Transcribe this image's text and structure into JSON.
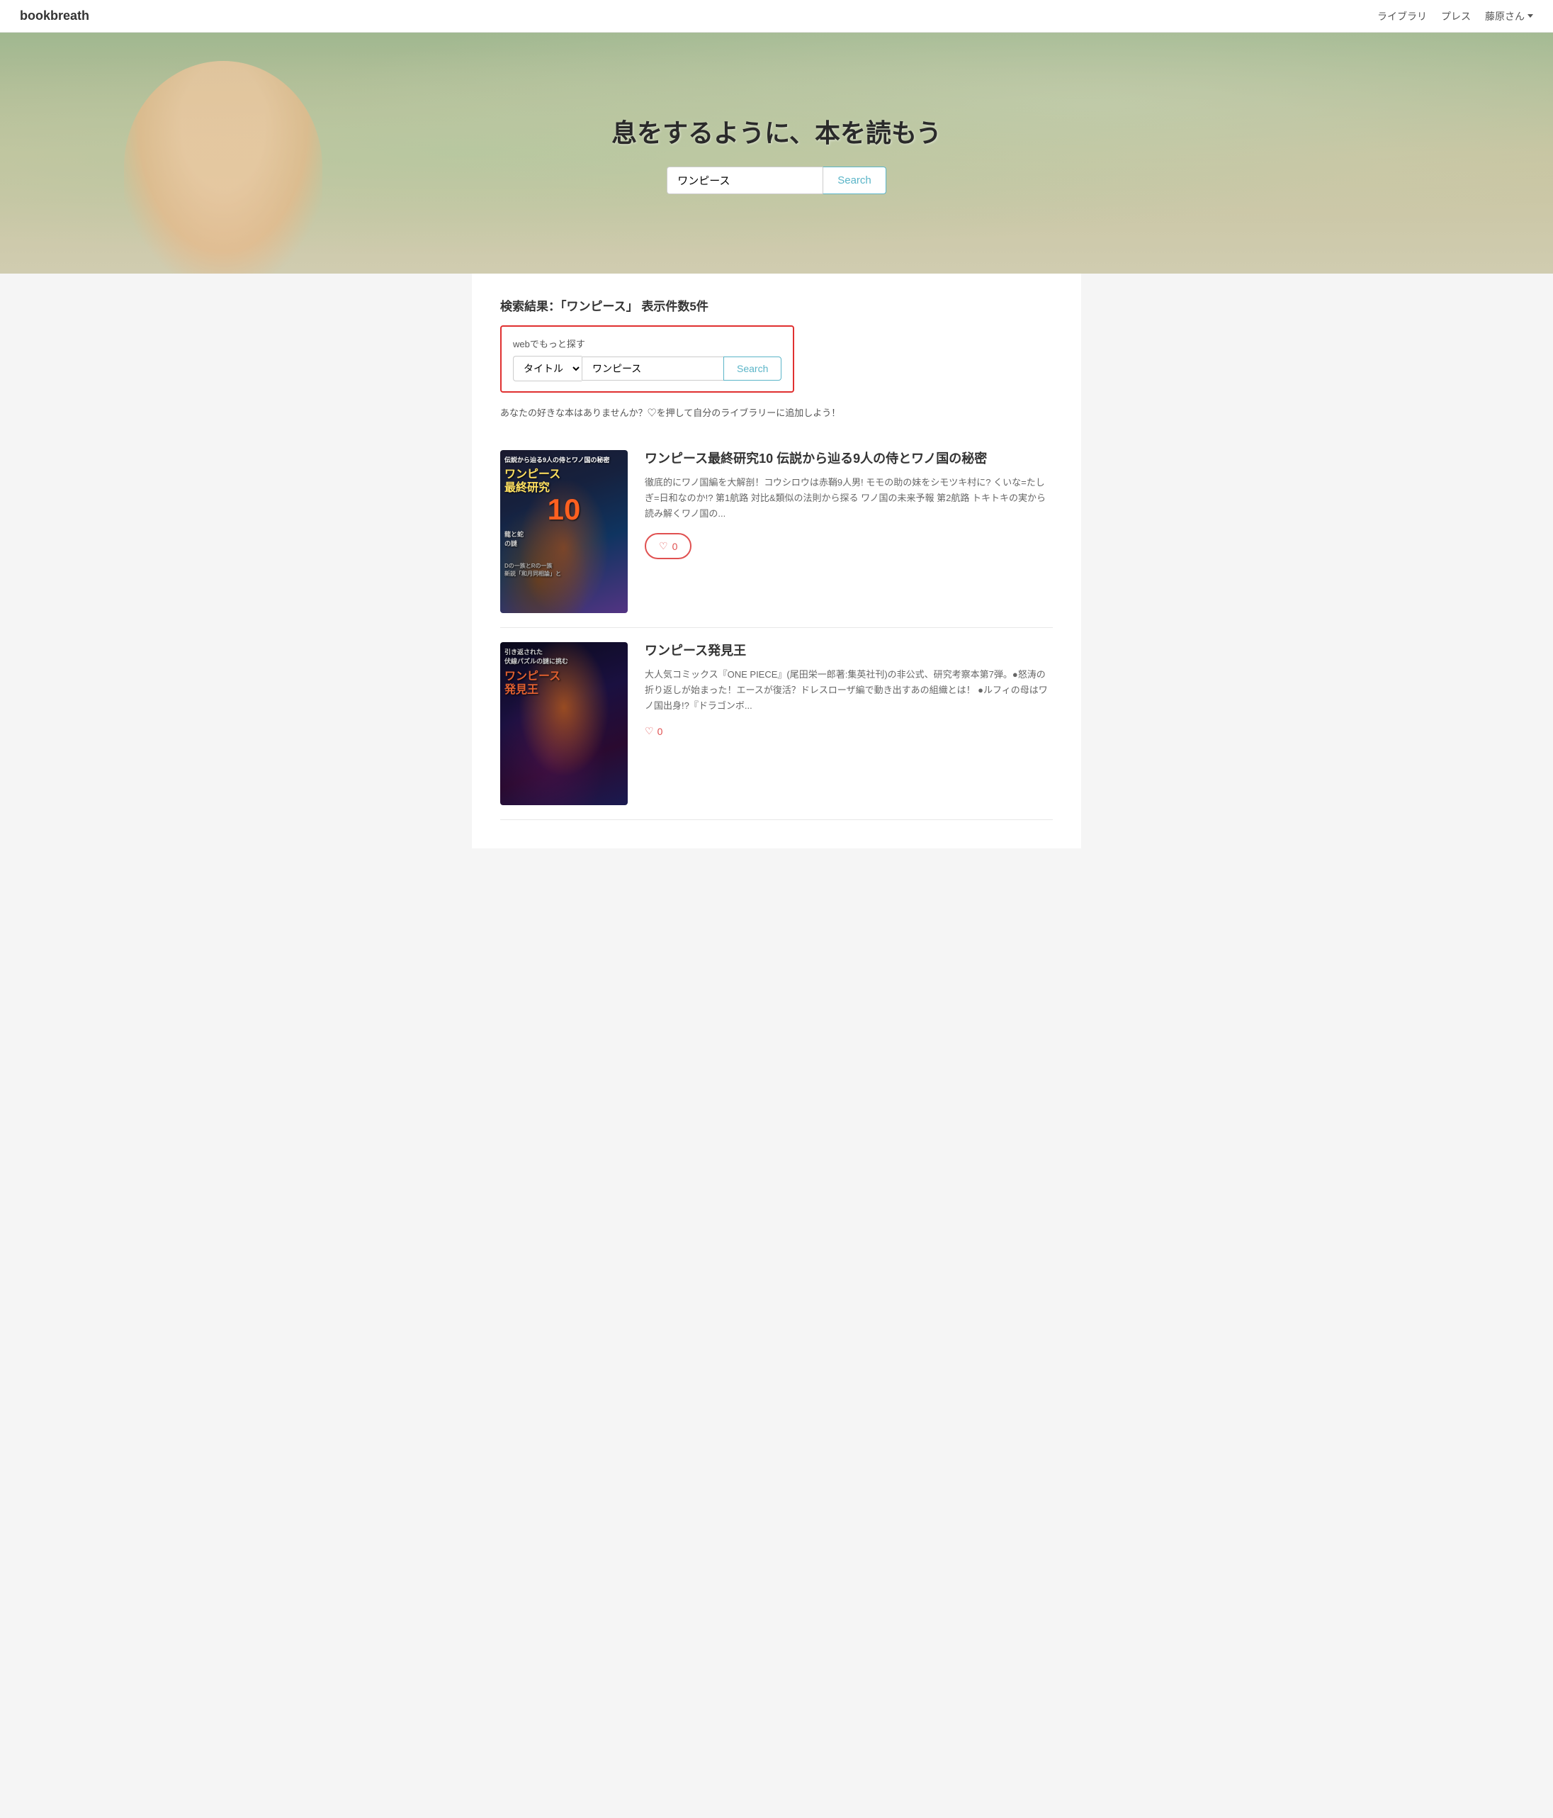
{
  "navbar": {
    "brand": "bookbreath",
    "links": {
      "library": "ライブラリ",
      "press": "プレス",
      "user": "藤原さん"
    }
  },
  "hero": {
    "title": "息をするように、本を読もう",
    "search_input_value": "ワンピース",
    "search_btn_label": "Search"
  },
  "results_section": {
    "heading": "検索結果：「ワンピース」 表示件数5件",
    "web_search_label": "webでもっと探す",
    "select_option": "タイトル",
    "search_input_value": "ワンピース",
    "search_btn_label": "Search",
    "hint_text": "あなたの好きな本はありませんか？♡を押して自分のライブラリーに追加しよう！"
  },
  "books": [
    {
      "title": "ワンピース最終研究10 伝説から辿る9人の侍とワノ国の秘密",
      "description": "徹底的にワノ国編を大解剖！コウシロウは赤鞘9人男! モモの助の妹をシモツキ村に? くいな=たしぎ=日和なのか!? 第1航路 対比&類似の法則から探る ワノ国の未来予報 第2航路 トキトキの実から読み解くワノ国の...",
      "like_count": "0",
      "cover_label_top": "伝説から辿る9人の侍とワノ国の秘密",
      "cover_title": "ワンピース\n最終研究",
      "cover_num": "10"
    },
    {
      "title": "ワンピース発見王",
      "description": "大人気コミックス『ONE PIECE』(尾田栄一郎著:集英社刊)の非公式、研究考察本第7弾。●怒涛の折り返しが始まった！エースが復活？ドレスローザ編で動き出すあの組織とは！ ●ルフィの母はワノ国出身!?『ドラゴンボ...",
      "like_count": "0",
      "cover_label_top": "引き返された\n伏線パズルの謎に挑む",
      "cover_title": "ワンピース\n発見王",
      "cover_num": ""
    }
  ],
  "icons": {
    "heart": "♡",
    "caret": "▾",
    "heart_filled": "♡"
  }
}
